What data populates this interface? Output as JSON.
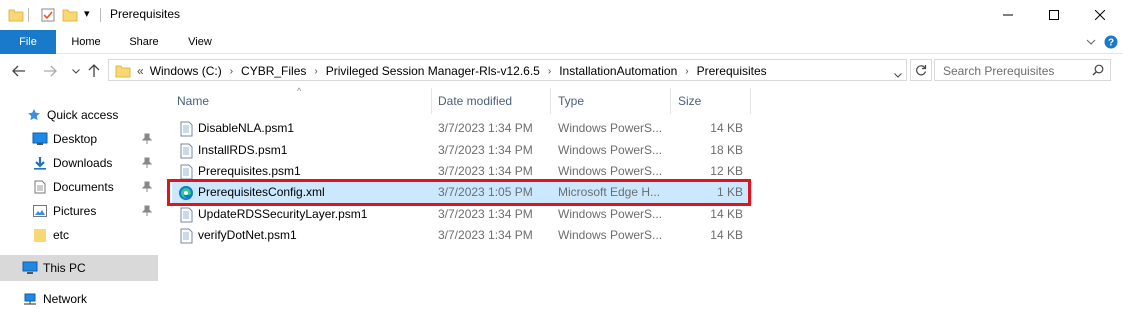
{
  "window": {
    "title": "Prerequisites",
    "qat_dropdown_glyph": "▾",
    "minimize_glyph": "—",
    "maximize_glyph": "☐",
    "close_glyph": "✕"
  },
  "ribbon": {
    "tabs": [
      "File",
      "Home",
      "Share",
      "View"
    ],
    "expand_glyph": "⌄",
    "help_glyph": "?"
  },
  "address": {
    "overflow": "«",
    "crumbs": [
      "Windows (C:)",
      "CYBR_Files",
      "Privileged Session Manager-Rls-v12.6.5",
      "InstallationAutomation",
      "Prerequisites"
    ],
    "separator": "›"
  },
  "search": {
    "placeholder": "Search Prerequisites"
  },
  "navigation": {
    "items": [
      {
        "label": "Quick access",
        "icon": "star-icon"
      },
      {
        "label": "Desktop",
        "icon": "desktop-icon",
        "pinned": true
      },
      {
        "label": "Downloads",
        "icon": "download-icon",
        "pinned": true
      },
      {
        "label": "Documents",
        "icon": "documents-icon",
        "pinned": true
      },
      {
        "label": "Pictures",
        "icon": "pictures-icon",
        "pinned": true
      },
      {
        "label": "etc",
        "icon": "folder-icon"
      },
      {
        "label": "This PC",
        "icon": "computer-icon",
        "selected": true
      },
      {
        "label": "Network",
        "icon": "network-icon"
      }
    ]
  },
  "columns": {
    "name": "Name",
    "date": "Date modified",
    "type": "Type",
    "size": "Size"
  },
  "files": [
    {
      "name": "DisableNLA.psm1",
      "date": "3/7/2023 1:34 PM",
      "type": "Windows PowerS...",
      "size": "14 KB",
      "icon": "powershell-file-icon"
    },
    {
      "name": "InstallRDS.psm1",
      "date": "3/7/2023 1:34 PM",
      "type": "Windows PowerS...",
      "size": "18 KB",
      "icon": "powershell-file-icon"
    },
    {
      "name": "Prerequisites.psm1",
      "date": "3/7/2023 1:34 PM",
      "type": "Windows PowerS...",
      "size": "12 KB",
      "icon": "powershell-file-icon"
    },
    {
      "name": "PrerequisitesConfig.xml",
      "date": "3/7/2023 1:05 PM",
      "type": "Microsoft Edge H...",
      "size": "1 KB",
      "icon": "edge-file-icon",
      "selected": true
    },
    {
      "name": "UpdateRDSSecurityLayer.psm1",
      "date": "3/7/2023 1:34 PM",
      "type": "Windows PowerS...",
      "size": "14 KB",
      "icon": "powershell-file-icon"
    },
    {
      "name": "verifyDotNet.psm1",
      "date": "3/7/2023 1:34 PM",
      "type": "Windows PowerS...",
      "size": "14 KB",
      "icon": "powershell-file-icon"
    }
  ],
  "colors": {
    "file_tab": "#1979ca",
    "selection": "#cce8ff",
    "highlight_border": "#e0141e",
    "folder": "#f8d775",
    "nav_selected": "#d9d9d9"
  }
}
